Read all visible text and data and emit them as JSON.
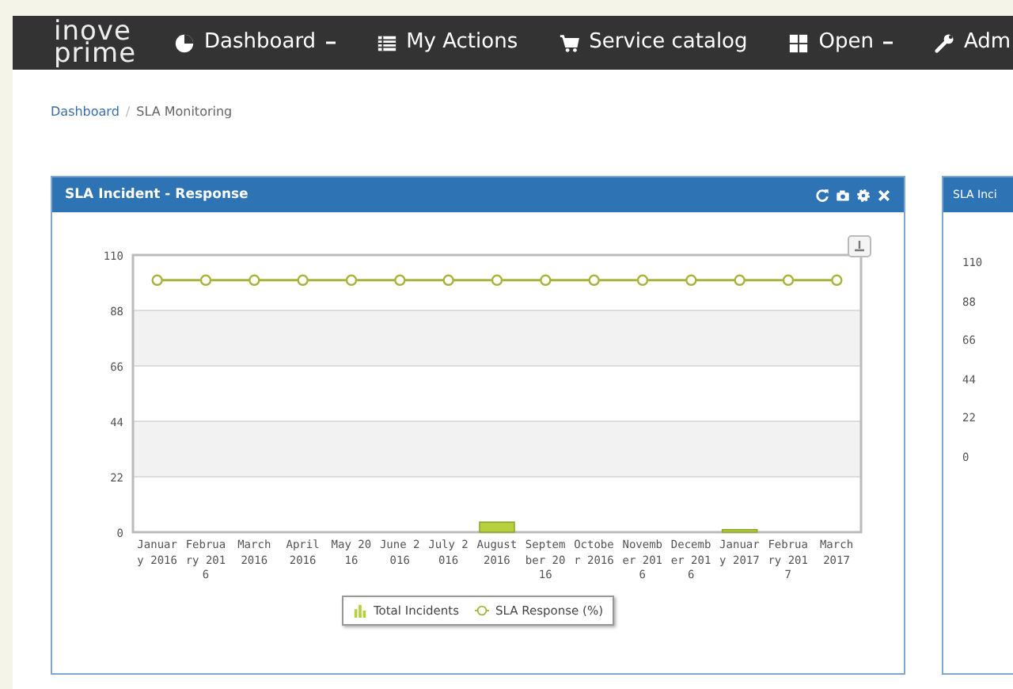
{
  "navbar": {
    "logo": [
      "inove",
      "prime"
    ],
    "items": [
      {
        "label": "Dashboard",
        "dropdown": true
      },
      {
        "label": "My Actions",
        "dropdown": false
      },
      {
        "label": "Service catalog",
        "dropdown": false
      },
      {
        "label": "Open",
        "dropdown": true
      },
      {
        "label": "Adm",
        "dropdown": false
      }
    ]
  },
  "breadcrumb": {
    "separator": "/",
    "items": [
      {
        "label": "Dashboard",
        "link": true
      },
      {
        "label": "SLA Monitoring",
        "link": false
      }
    ]
  },
  "panels": [
    {
      "title": "SLA Incident - Response",
      "chart_data": {
        "type": "bar",
        "categories": [
          "January 2016",
          "February 2016",
          "March 2016",
          "April 2016",
          "May 2016",
          "June 2016",
          "July 2016",
          "August 2016",
          "September 2016",
          "October 2016",
          "November 2016",
          "December 2016",
          "January 2017",
          "February 2017",
          "March 2017"
        ],
        "series": [
          {
            "name": "Total Incidents",
            "color": "#b5cf3e",
            "values": [
              0,
              0,
              0,
              0,
              0,
              0,
              0,
              4,
              0,
              0,
              0,
              0,
              1,
              0,
              0
            ]
          },
          {
            "name": "SLA Response (%)",
            "type": "line",
            "marker": "circle",
            "color": "#a8b43c",
            "values": [
              100,
              100,
              100,
              100,
              100,
              100,
              100,
              100,
              100,
              100,
              100,
              100,
              100,
              100,
              100
            ]
          }
        ],
        "ylim": [
          0,
          110
        ],
        "grid": true,
        "legend": "bottom",
        "yticks": [
          0,
          22,
          44,
          66,
          88,
          110
        ]
      }
    },
    {
      "title": "SLA Inci",
      "yticks": [
        "110",
        "88",
        "66",
        "44",
        "22",
        "0"
      ]
    }
  ]
}
